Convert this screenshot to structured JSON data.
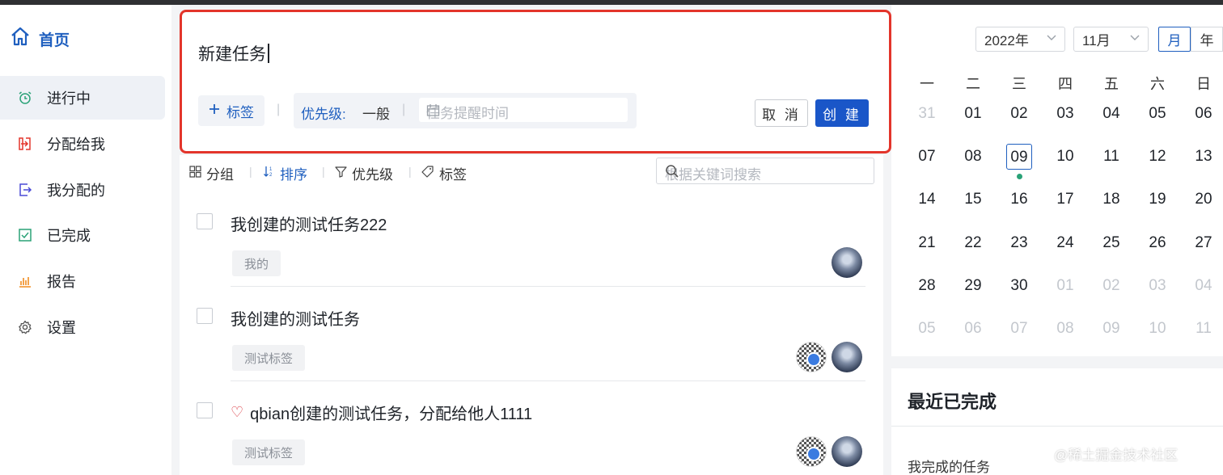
{
  "sidebar": {
    "home_label": "首页",
    "items": [
      {
        "label": "进行中",
        "icon": "alarm-icon",
        "color": "#2aa277"
      },
      {
        "label": "分配给我",
        "icon": "inbox-in-icon",
        "color": "#e3352b"
      },
      {
        "label": "我分配的",
        "icon": "outbox-icon",
        "color": "#4a4ad6"
      },
      {
        "label": "已完成",
        "icon": "check-box-icon",
        "color": "#2aa277"
      },
      {
        "label": "报告",
        "icon": "bar-chart-icon",
        "color": "#f08c1f"
      },
      {
        "label": "设置",
        "icon": "gear-icon",
        "color": "#555555"
      }
    ]
  },
  "create_form": {
    "title_value": "新建任务",
    "tag_button": "标签",
    "priority_label": "优先级:",
    "priority_value": "一般",
    "remind_placeholder": "任务提醒时间",
    "cancel": "取 消",
    "create": "创 建"
  },
  "toolbar": {
    "group": "分组",
    "sort": "排序",
    "priority": "优先级",
    "tag": "标签",
    "search_placeholder": "根据关键词搜索"
  },
  "tasks": [
    {
      "title": "我创建的测试任务222",
      "tag": "我的",
      "favorite": false
    },
    {
      "title": "我创建的测试任务",
      "tag": "测试标签",
      "favorite": false
    },
    {
      "title": "qbian创建的测试任务，分配给他人1111",
      "tag": "测试标签",
      "favorite": true
    }
  ],
  "calendar": {
    "year": "2022年",
    "month": "11月",
    "mode_month": "月",
    "mode_year": "年",
    "weekdays": [
      "一",
      "二",
      "三",
      "四",
      "五",
      "六",
      "日"
    ],
    "weeks": [
      [
        "31",
        "01",
        "02",
        "03",
        "04",
        "05",
        "06"
      ],
      [
        "07",
        "08",
        "09",
        "10",
        "11",
        "12",
        "13"
      ],
      [
        "14",
        "15",
        "16",
        "17",
        "18",
        "19",
        "20"
      ],
      [
        "21",
        "22",
        "23",
        "24",
        "25",
        "26",
        "27"
      ],
      [
        "28",
        "29",
        "30",
        "01",
        "02",
        "03",
        "04"
      ],
      [
        "05",
        "06",
        "07",
        "08",
        "09",
        "10",
        "11"
      ]
    ],
    "today": "09"
  },
  "recent_done": {
    "title": "最近已完成",
    "item": "我完成的任务"
  },
  "watermark": "@稀土掘金技术社区",
  "colors": {
    "accent": "#1f5fbf",
    "primary_button": "#1a56c8",
    "highlight_border": "#e3352b"
  }
}
